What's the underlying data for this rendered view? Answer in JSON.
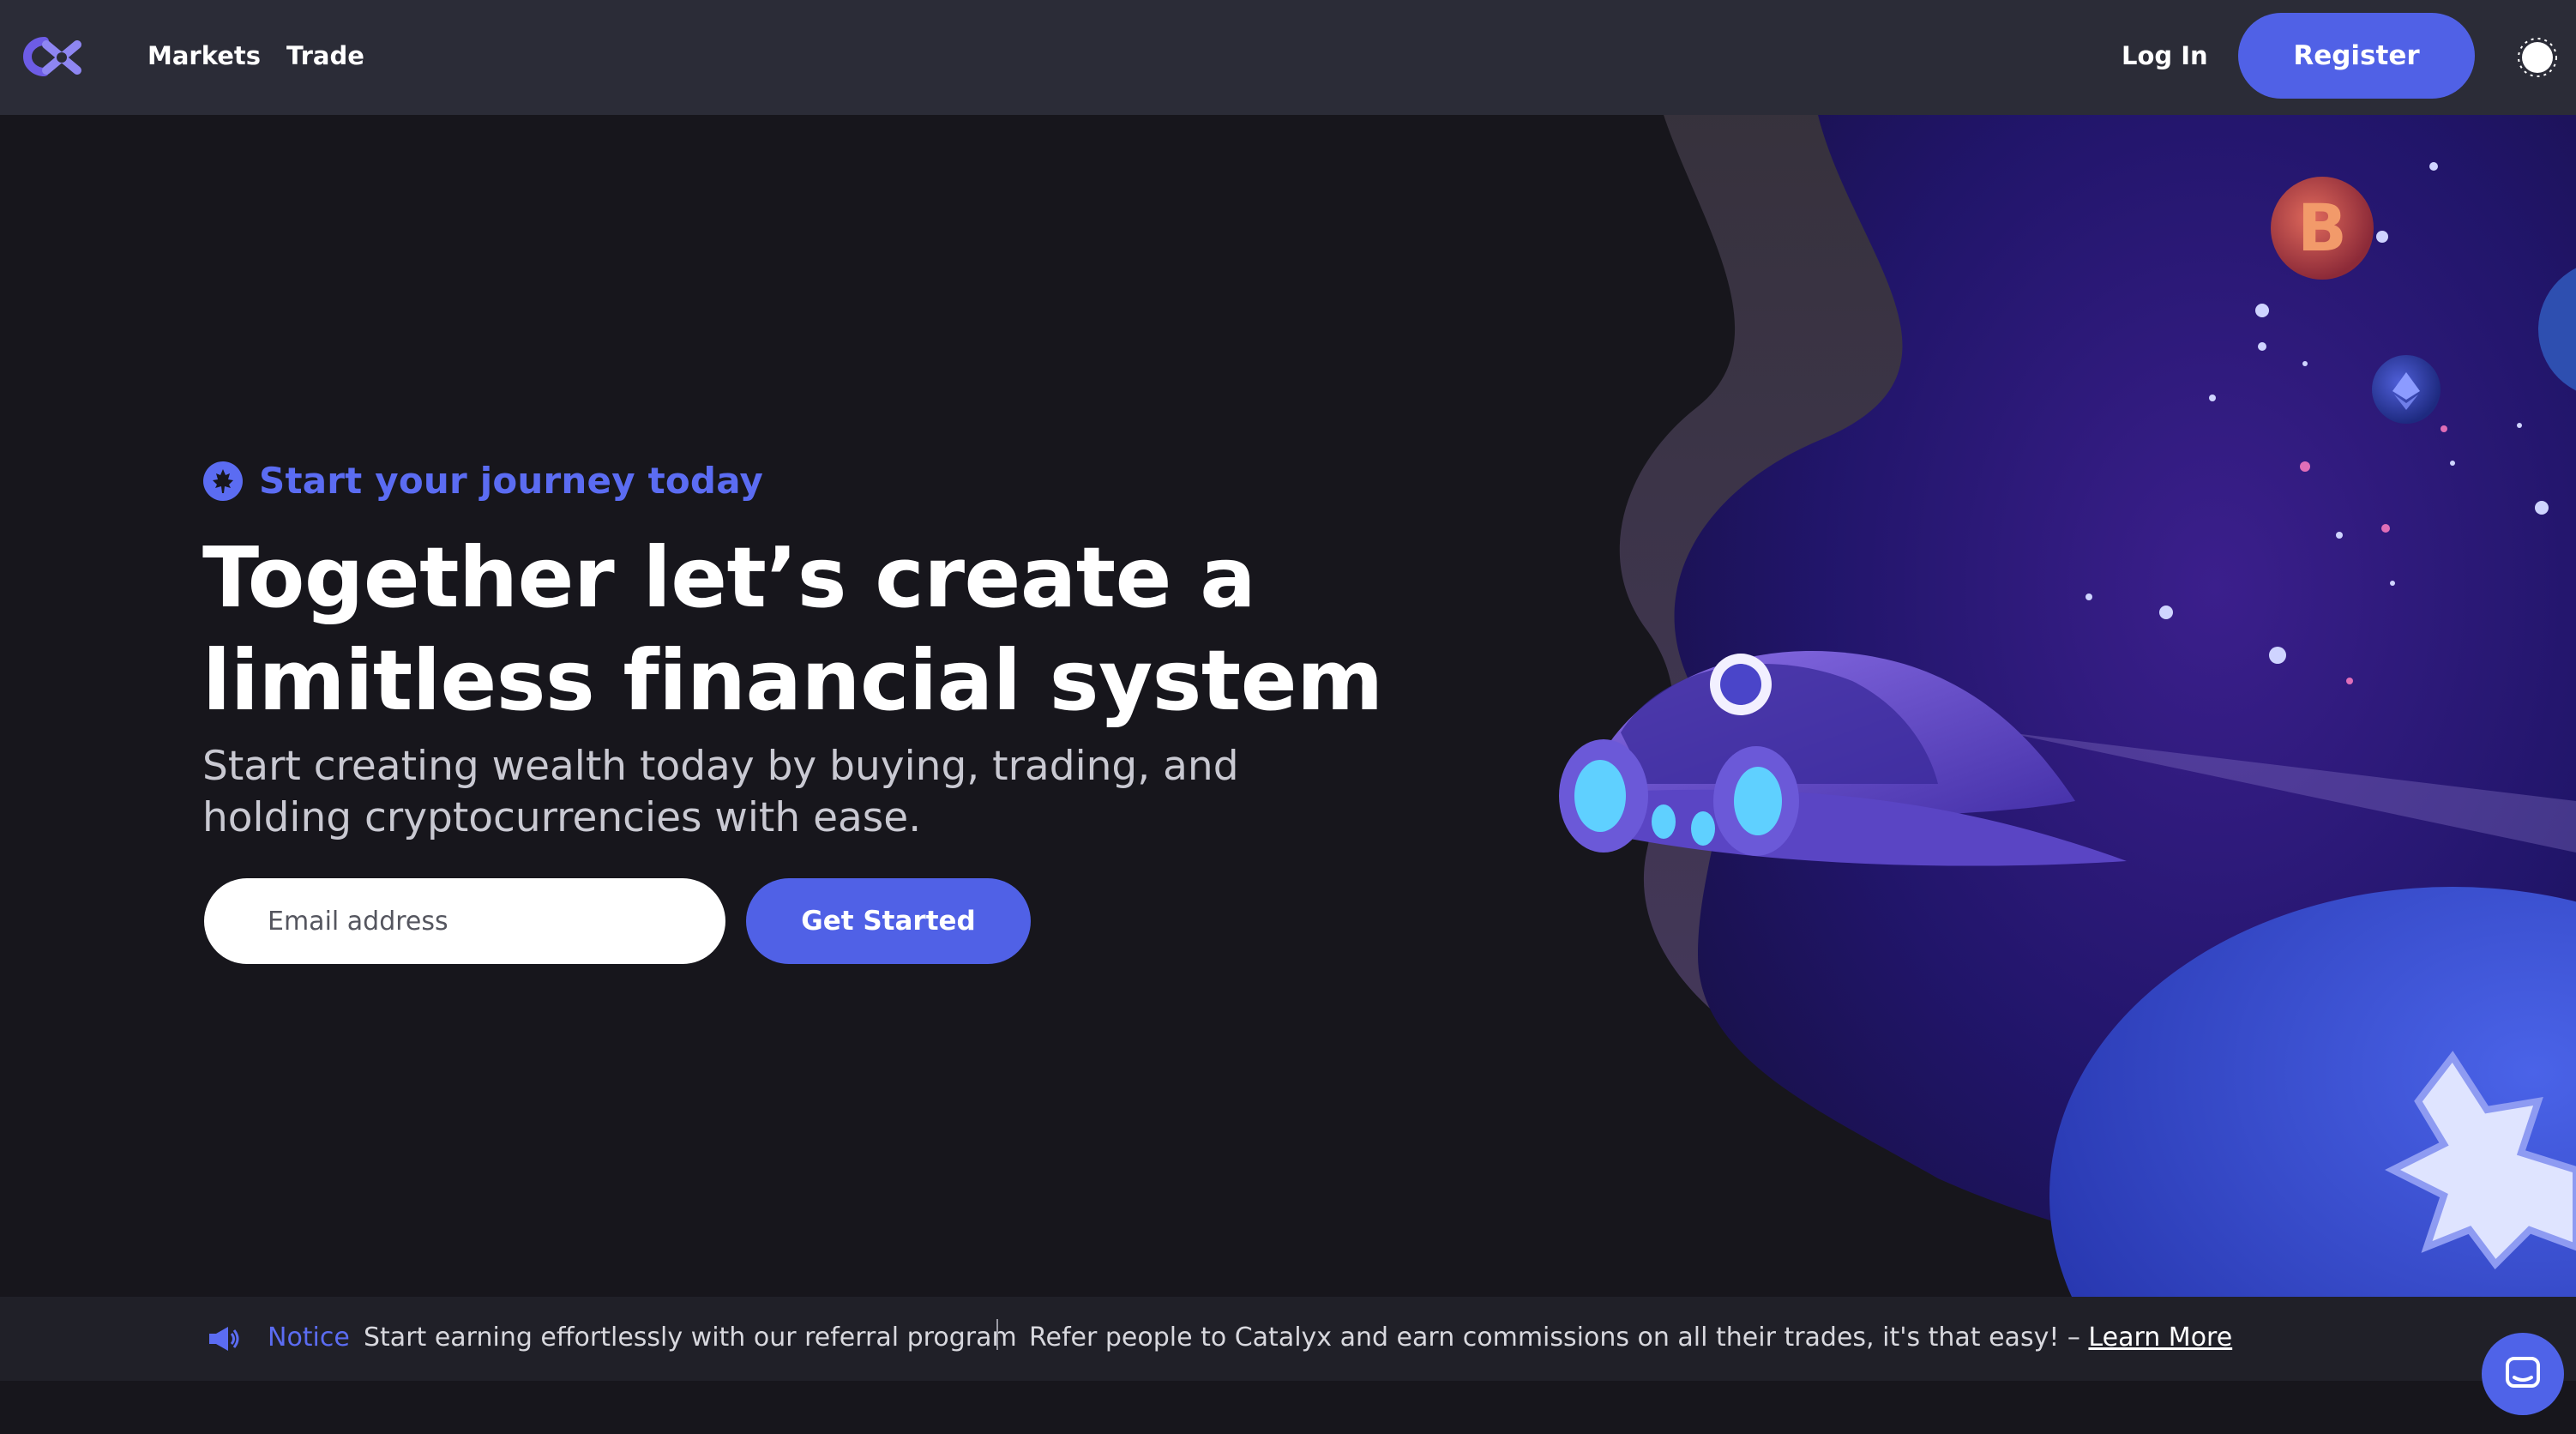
{
  "nav": {
    "logo_icon": "catalyx-logo-icon",
    "links": [
      "Markets",
      "Trade"
    ],
    "login_label": "Log In",
    "register_label": "Register",
    "theme_icon": "sun-icon"
  },
  "hero": {
    "eyebrow_icon": "maple-leaf-icon",
    "eyebrow": "Start your journey today",
    "headline_line1": "Together let’s create a",
    "headline_line2": "limitless financial system",
    "subhead_line1": "Start creating wealth today by buying, trading, and",
    "subhead_line2": "holding cryptocurrencies with ease.",
    "email_placeholder": "Email address",
    "cta_label": "Get Started",
    "art_planet_letter": "B"
  },
  "notice": {
    "icon": "megaphone-icon",
    "label": "Notice",
    "headline": "Start earning effortlessly with our referral program",
    "body": "Refer people to Catalyx and earn commissions on all their trades, it's that easy! – ",
    "link": "Learn More"
  },
  "chat": {
    "icon": "chat-icon"
  },
  "colors": {
    "accent": "#5061e6",
    "nav_bg": "#2b2c37",
    "page_bg": "#17161c",
    "notice_bg": "#202028"
  }
}
